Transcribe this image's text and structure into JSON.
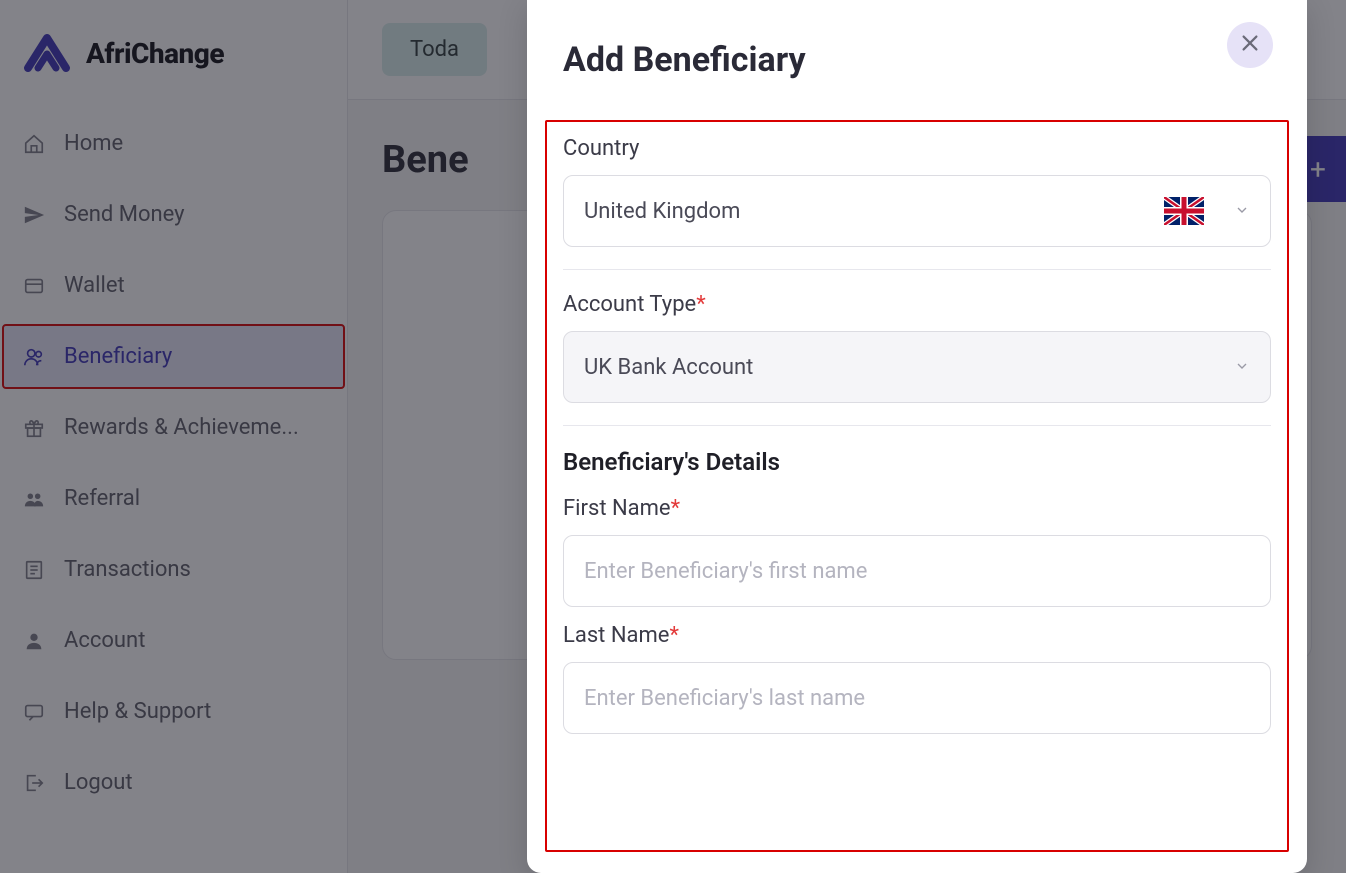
{
  "brand": {
    "name": "AfriChange"
  },
  "sidebar": {
    "items": [
      {
        "label": "Home",
        "icon": "home"
      },
      {
        "label": "Send Money",
        "icon": "send"
      },
      {
        "label": "Wallet",
        "icon": "wallet"
      },
      {
        "label": "Beneficiary",
        "icon": "user-group",
        "active": true
      },
      {
        "label": "Rewards & Achieveme...",
        "icon": "gift"
      },
      {
        "label": "Referral",
        "icon": "users"
      },
      {
        "label": "Transactions",
        "icon": "list"
      },
      {
        "label": "Account",
        "icon": "person"
      },
      {
        "label": "Help & Support",
        "icon": "message"
      },
      {
        "label": "Logout",
        "icon": "logout"
      }
    ]
  },
  "topbar": {
    "today_label": "Toda"
  },
  "page": {
    "title": "Bene"
  },
  "modal": {
    "title": "Add Beneficiary",
    "country_label": "Country",
    "country_value": "United Kingdom",
    "account_type_label": "Account Type",
    "account_type_value": "UK Bank Account",
    "section_title": "Beneficiary's Details",
    "first_name_label": "First Name",
    "first_name_placeholder": "Enter Beneficiary's first name",
    "last_name_label": "Last Name",
    "last_name_placeholder": "Enter Beneficiary's last name"
  }
}
